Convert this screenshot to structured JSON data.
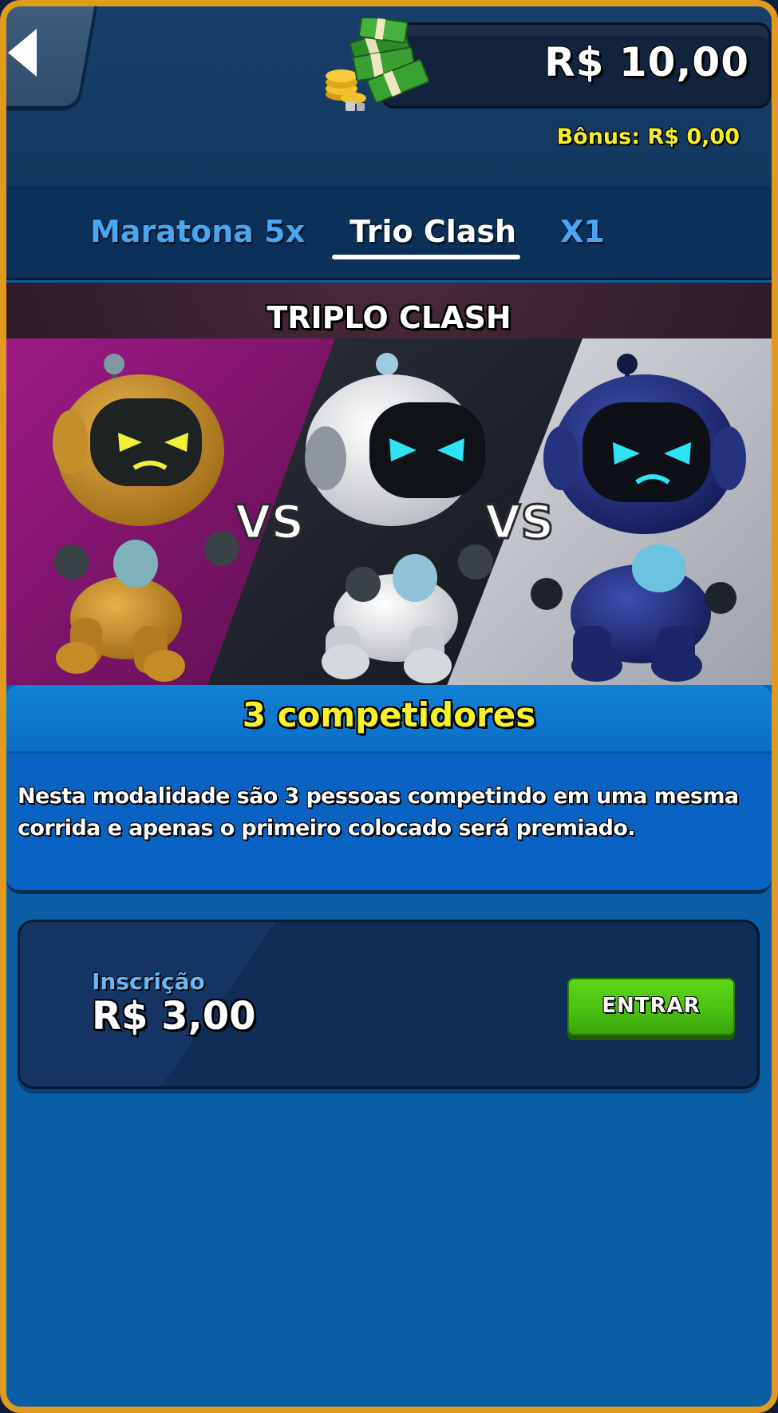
{
  "header": {
    "balance": "R$ 10,00",
    "bonus": "Bônus: R$ 0,00"
  },
  "tabs": [
    {
      "label": "Maratona 5x",
      "active": false
    },
    {
      "label": "Trio Clash",
      "active": true
    },
    {
      "label": "X1",
      "active": false
    }
  ],
  "banner": {
    "title": "TRIPLO CLASH",
    "vs_left": "VS",
    "vs_right": "VS",
    "robots": [
      "yellow-robot",
      "white-robot",
      "blue-robot"
    ]
  },
  "info": {
    "title": "3 competidores",
    "description": "Nesta modalidade são 3 pessoas competindo em uma mesma corrida e apenas o primeiro colocado será premiado."
  },
  "entry": {
    "label": "Inscrição",
    "price": "R$ 3,00",
    "button": "ENTRAR"
  },
  "colors": {
    "frame": "#e09a1e",
    "accent_yellow": "#f9f22a",
    "enter_green": "#4cc212",
    "tab_inactive": "#4aa6f1"
  }
}
